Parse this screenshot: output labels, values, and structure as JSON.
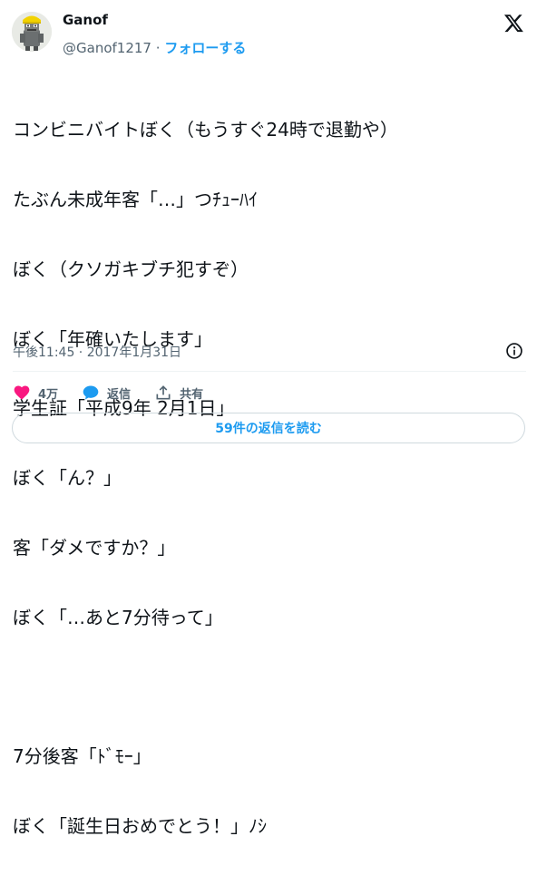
{
  "author": {
    "name": "Ganof",
    "handle": "@Ganof1217",
    "separator": "·",
    "follow_label": "フォローする"
  },
  "tweet": {
    "lines": [
      "コンビニバイトぼく（もうすぐ24時で退勤や）",
      "たぶん未成年客「…」つﾁｭｰﾊｲ",
      "ぼく（クソガキブチ犯すぞ）",
      "ぼく「年確いたします」",
      "学生証「平成9年 2月1日」",
      "ぼく「ん？」",
      "客「ダメですか？」",
      "ぼく「…あと7分待って」",
      "",
      "7分後客「ﾄﾞﾓｰ」",
      "ぼく「誕生日おめでとう！」ﾉｼ"
    ],
    "timestamp": "午後11:45 · 2017年1月31日"
  },
  "actions": {
    "likes": "4万",
    "reply_label": "返信",
    "share_label": "共有"
  },
  "replies_button": "59件の返信を読む",
  "colors": {
    "accent": "#1d9bf0",
    "like": "#f91880",
    "text": "#0f1419",
    "muted": "#536471",
    "border": "#cfd9de"
  },
  "icons": [
    "x-logo-icon",
    "info-icon",
    "heart-icon",
    "reply-bubble-icon",
    "share-icon"
  ]
}
